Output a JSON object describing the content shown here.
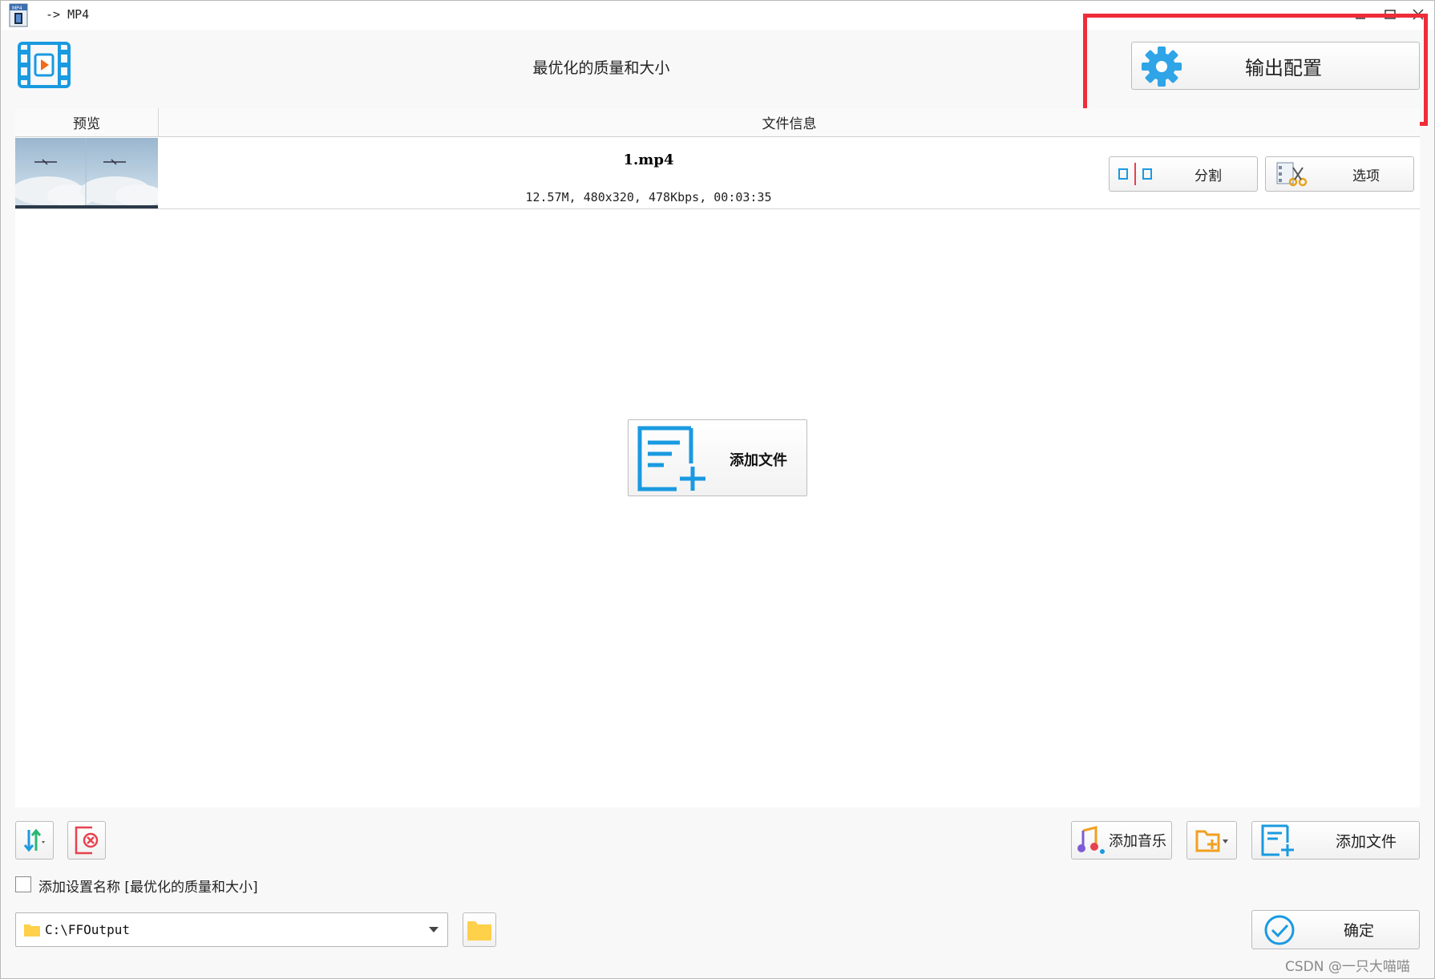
{
  "window": {
    "title": "-> MP4",
    "controls": [
      "minimize",
      "maximize",
      "close"
    ]
  },
  "header": {
    "title": "最优化的质量和大小",
    "config_button": "输出配置"
  },
  "file_list": {
    "columns": [
      "预览",
      "文件信息"
    ],
    "rows": [
      {
        "name": "1.mp4",
        "info": "12.57M, 480x320, 478Kbps, 00:03:35",
        "split_button": "分割",
        "options_button": "选项"
      }
    ],
    "add_file_button": "添加文件"
  },
  "bottom": {
    "add_music_button": "添加音乐",
    "add_file_button": "添加文件",
    "add_setting_name_label": "添加设置名称 [最优化的质量和大小]",
    "add_setting_name_checked": false,
    "output_path": "C:\\FFOutput",
    "ok_button": "确定"
  },
  "watermark": "CSDN @一只大喵喵",
  "colors": {
    "accent_blue": "#1a9ae0",
    "highlight_red": "#ee2d38",
    "folder_yellow": "#ffd04a"
  }
}
